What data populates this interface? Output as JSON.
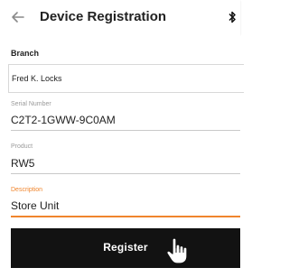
{
  "header": {
    "back_icon": "arrow-left-icon",
    "title": "Device Registration",
    "status_icon": "bluetooth-icon"
  },
  "form": {
    "branch": {
      "label": "Branch",
      "value": "Fred K. Locks"
    },
    "serial_number": {
      "label": "Serial Number",
      "value": "C2T2-1GWW-9C0AM"
    },
    "product": {
      "label": "Product",
      "value": "RW5"
    },
    "description": {
      "label": "Description",
      "value": "Store Unit",
      "focused": true
    }
  },
  "register_button": {
    "label": "Register",
    "pointer_icon": "hand-pointer-icon"
  },
  "colors": {
    "accent": "#f0852d",
    "button_bg": "#121212",
    "label_gray": "#9a9a9a"
  }
}
